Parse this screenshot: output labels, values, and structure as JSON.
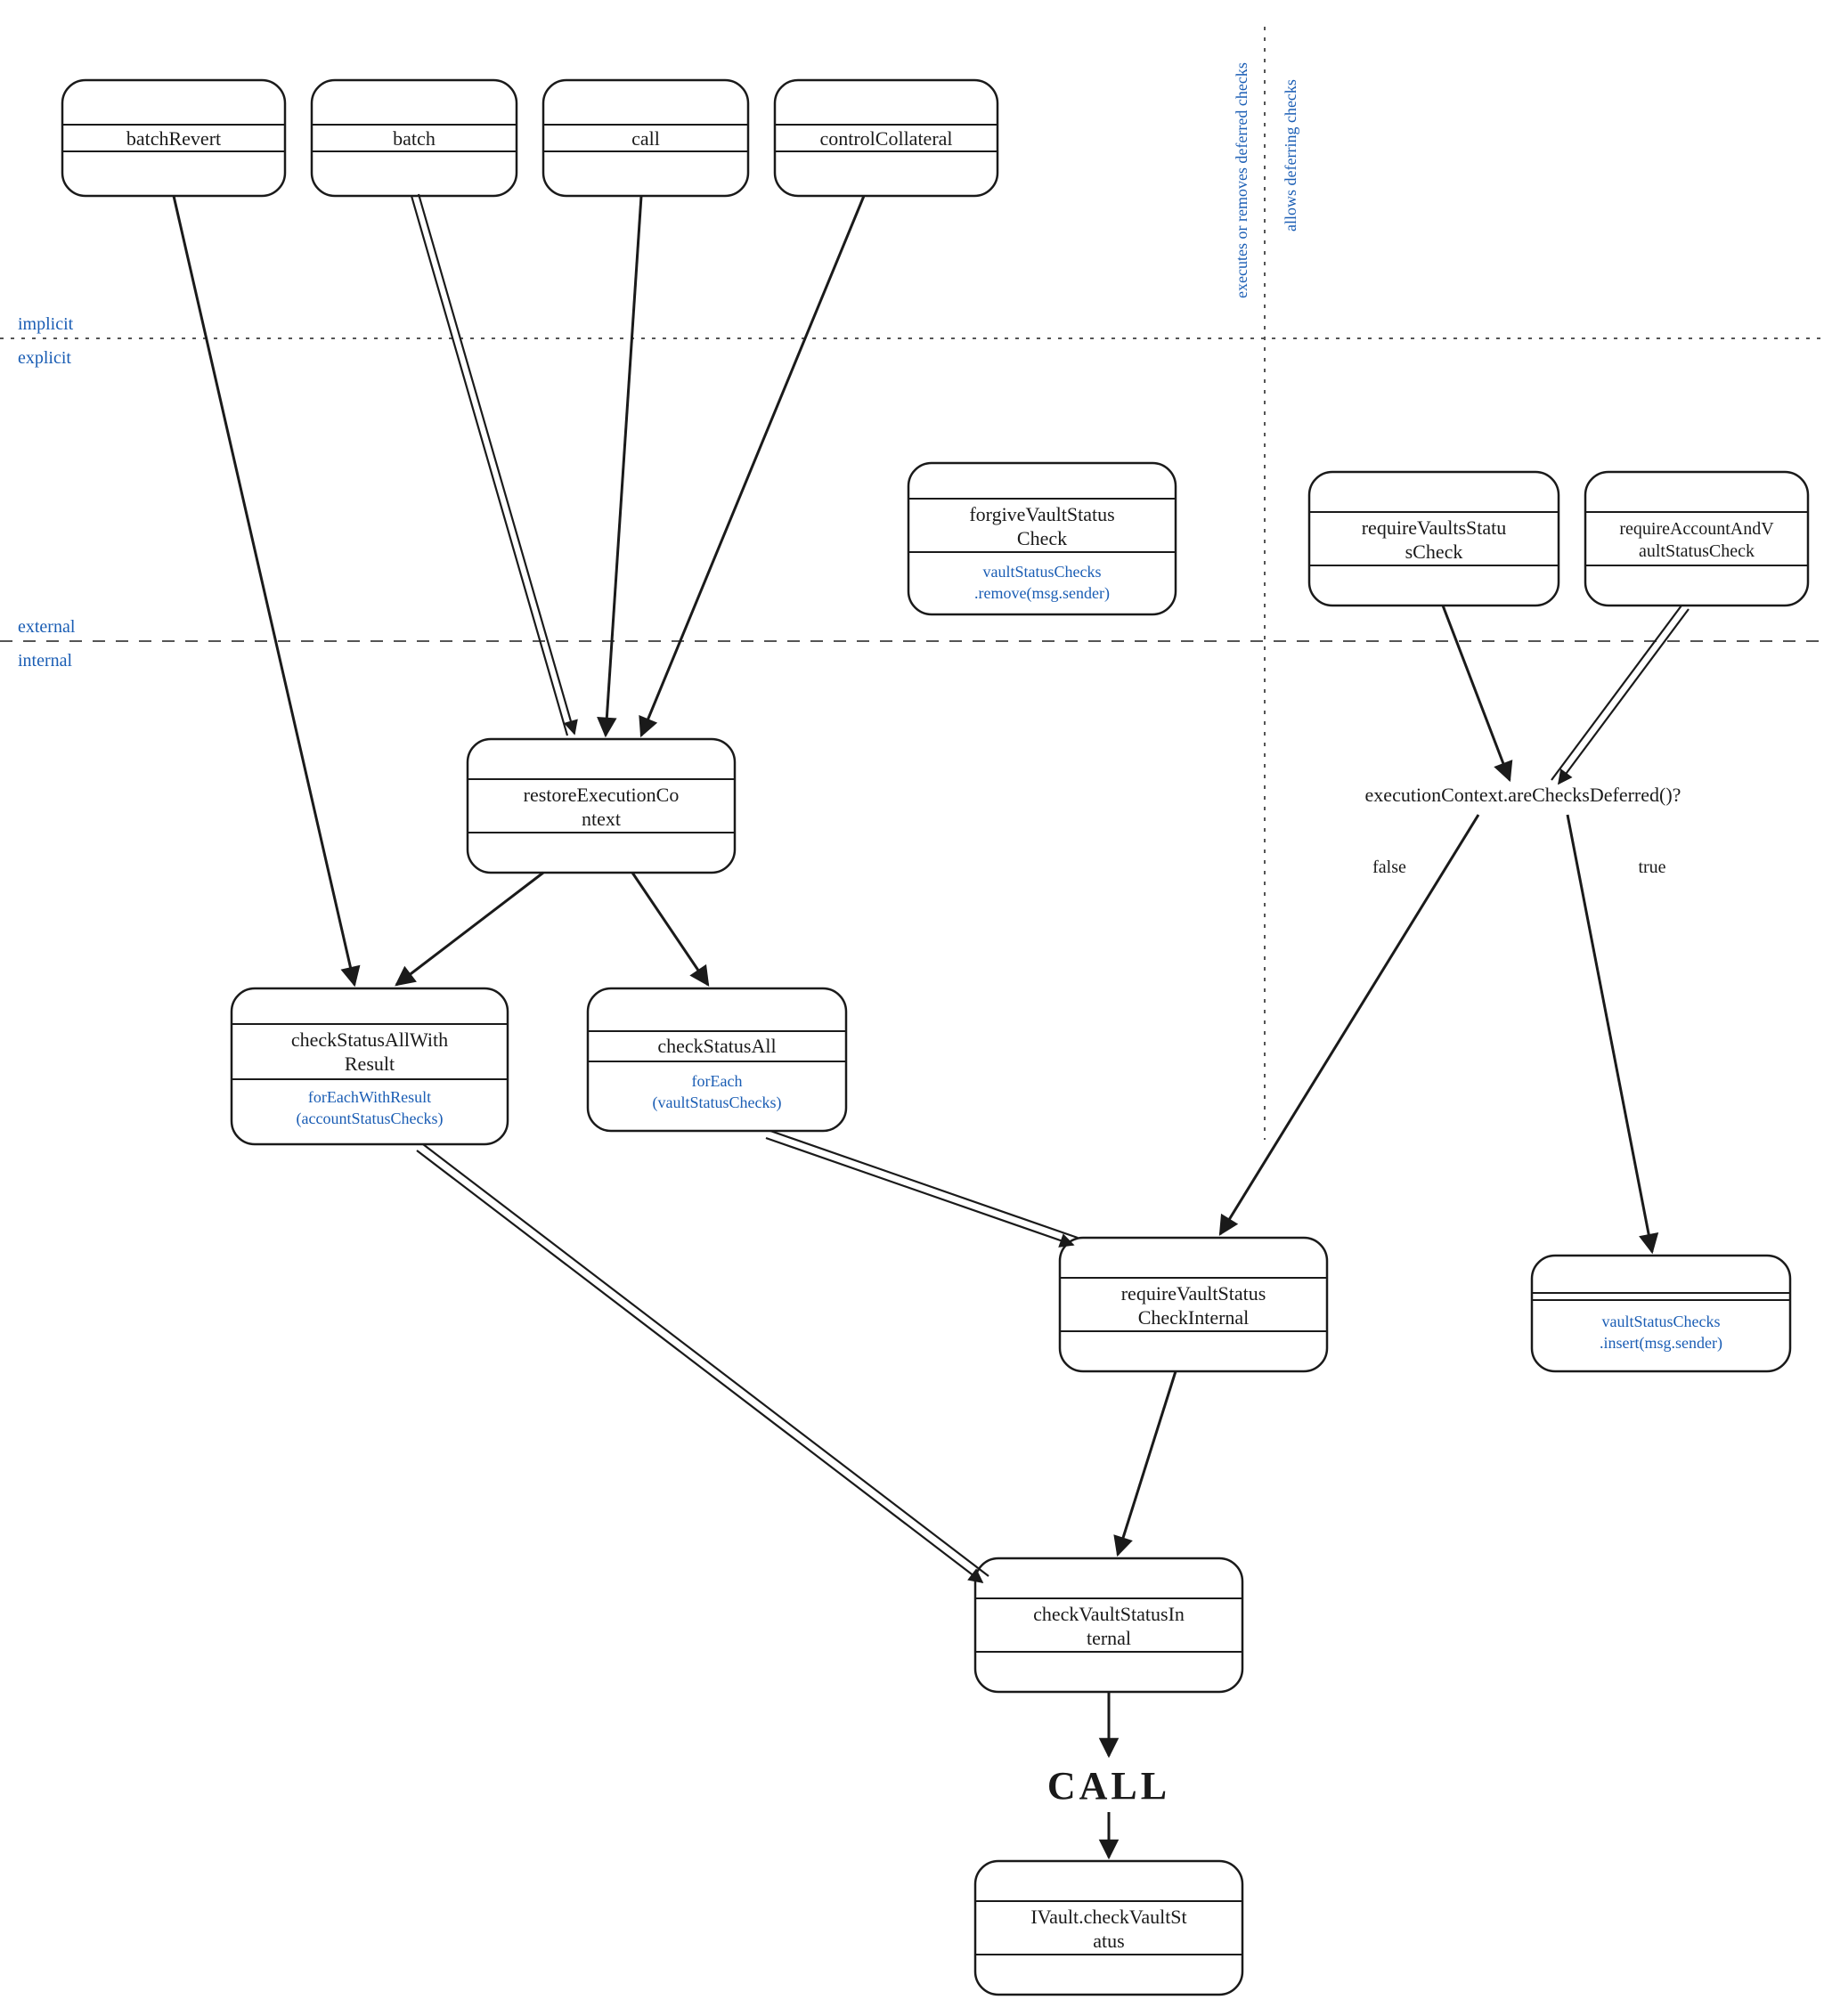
{
  "labels": {
    "implicit": "implicit",
    "explicit": "explicit",
    "external": "external",
    "internal": "internal",
    "executes": "executes or removes deferred checks",
    "allows": "allows deferring checks",
    "question": "executionContext.areChecksDeferred()?",
    "false": "false",
    "true": "true",
    "call": "CALL"
  },
  "nodes": {
    "batchRevert": {
      "t1": "batchRevert"
    },
    "batch": {
      "t1": "batch"
    },
    "callNode": {
      "t1": "call"
    },
    "controlCollateral": {
      "t1": "controlCollateral"
    },
    "forgive": {
      "t1": "forgiveVaultStatus",
      "t2": "Check",
      "s1": "vaultStatusChecks",
      "s2": ".remove(msg.sender)"
    },
    "reqVaults": {
      "t1": "requireVaultsStatu",
      "t2": "sCheck"
    },
    "reqAcct": {
      "t1": "requireAccountAndV",
      "t2": "aultStatusCheck"
    },
    "restore": {
      "t1": "restoreExecutionCo",
      "t2": "ntext"
    },
    "checkAllResult": {
      "t1": "checkStatusAllWith",
      "t2": "Result",
      "s1": "forEachWithResult",
      "s2": "(accountStatusChecks)"
    },
    "checkAll": {
      "t1": "checkStatusAll",
      "s1": "forEach",
      "s2": "(vaultStatusChecks)"
    },
    "reqInternal": {
      "t1": "requireVaultStatus",
      "t2": "CheckInternal"
    },
    "insertBox": {
      "s1": "vaultStatusChecks",
      "s2": ".insert(msg.sender)"
    },
    "checkVaultInt": {
      "t1": "checkVaultStatusIn",
      "t2": "ternal"
    },
    "ivault": {
      "t1": "IVault.checkVaultSt",
      "t2": "atus"
    }
  }
}
